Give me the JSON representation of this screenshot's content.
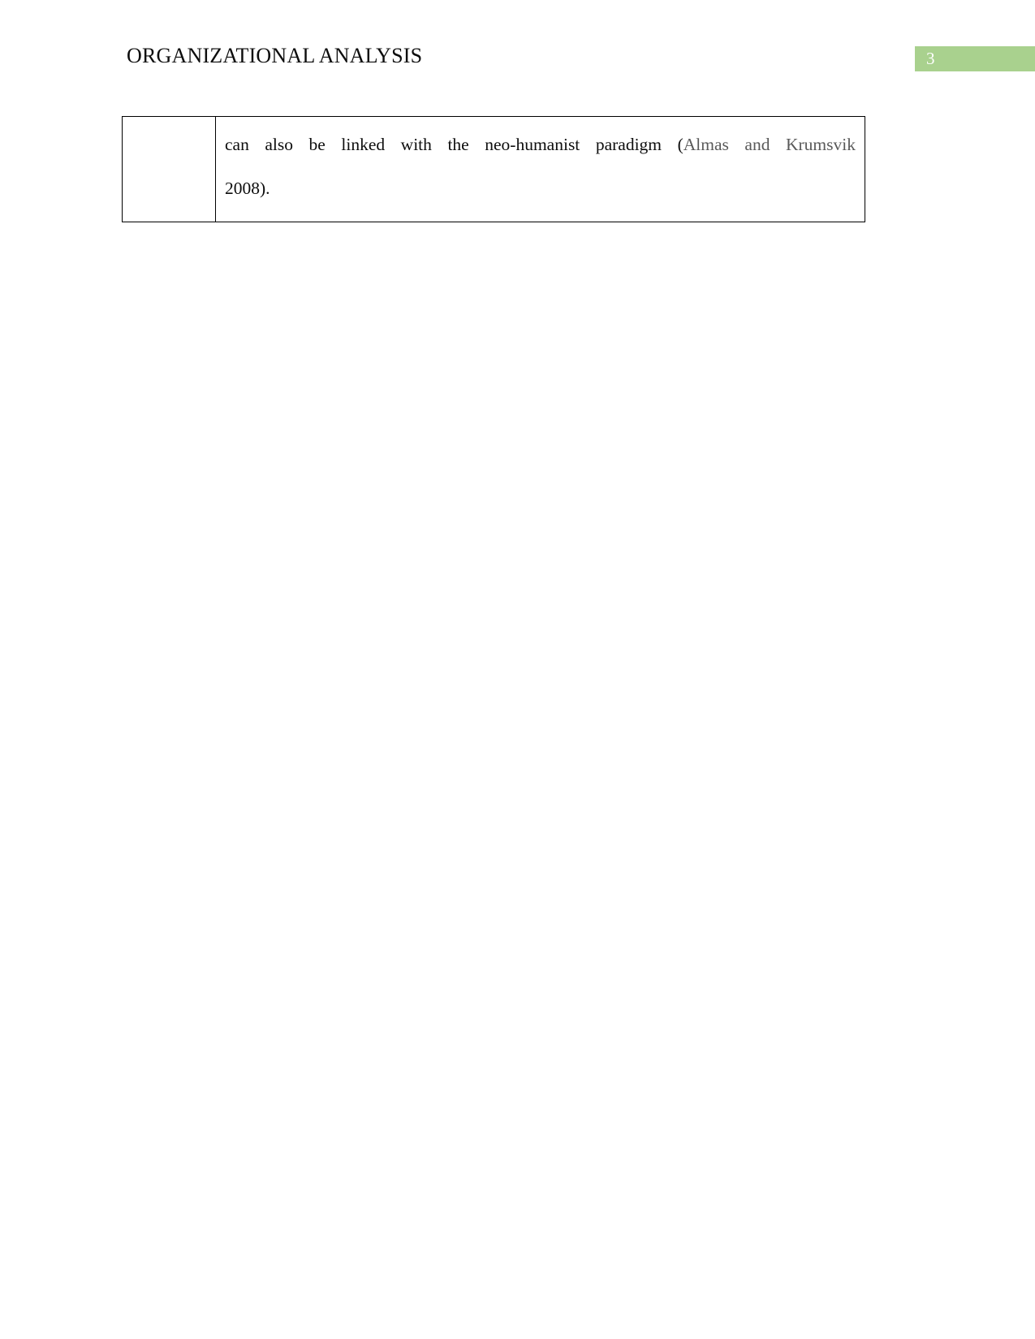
{
  "document": {
    "header": {
      "title": "ORGANIZATIONAL ANALYSIS",
      "page_number": "3",
      "badge_color": "#A9D18E",
      "page_number_color": "#FFFFFF"
    },
    "table": {
      "rows": [
        {
          "label_cell": "",
          "body_cell": {
            "line_1_main": "can also be linked with the neo-humanist paradigm (",
            "line_1_citation": "Almas and Krumsvik",
            "line_2": "2008).",
            "citation_color": "#5A5A5A",
            "full_text": "can also be linked with the neo-humanist paradigm (Almas and Krumsvik 2008)."
          }
        }
      ]
    }
  }
}
